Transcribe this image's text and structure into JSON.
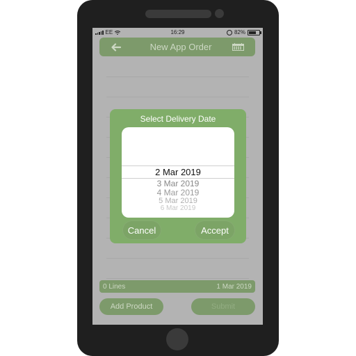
{
  "status_bar": {
    "carrier": "EE",
    "time": "16:29",
    "battery_percent": "82%",
    "battery_level": 0.82
  },
  "nav": {
    "title": "New App Order",
    "back_icon": "chevron-left-icon",
    "calendar_icon": "calendar-icon"
  },
  "dialog": {
    "title": "Select Delivery Date",
    "picker_options": [
      "2 Mar 2019",
      "3 Mar 2019",
      "4 Mar 2019",
      "5 Mar 2019",
      "6 Mar 2019"
    ],
    "selected_index": 0,
    "cancel_label": "Cancel",
    "accept_label": "Accept"
  },
  "footer": {
    "lines_count": "0 Lines",
    "date": "1 Mar 2019"
  },
  "actions": {
    "add_product_label": "Add Product",
    "submit_label": "Submit"
  },
  "colors": {
    "accent_green": "#80ad69",
    "dimmed_green": "#7d9a6b",
    "phone_body": "#1f1f1f",
    "overlay_gray": "#b3b3b3"
  }
}
